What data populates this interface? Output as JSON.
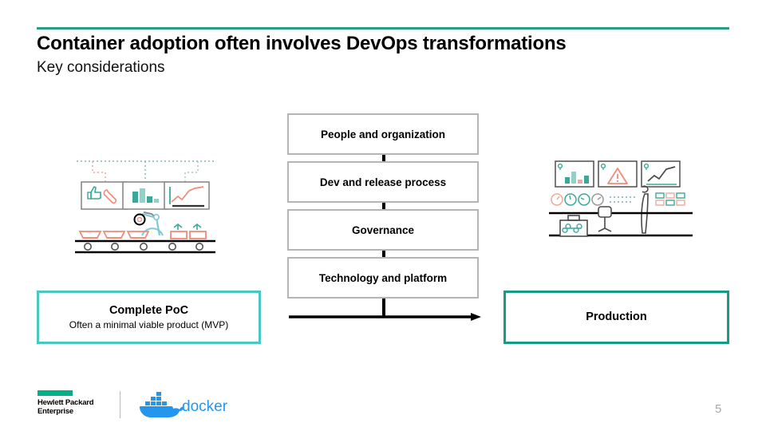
{
  "header": {
    "title": "Container adoption often involves DevOps transformations",
    "subtitle": "Key considerations",
    "rule_color": "#2a9d87"
  },
  "stack": {
    "boxes": [
      {
        "label": "People and organization"
      },
      {
        "label": "Dev and release process"
      },
      {
        "label": "Governance"
      },
      {
        "label": "Technology and platform"
      }
    ],
    "border_color": "#b5b5b5",
    "connector_color": "#000000"
  },
  "arrow": {
    "name": "progress-arrow",
    "direction": "right",
    "color": "#000000"
  },
  "callouts": {
    "left": {
      "title": "Complete PoC",
      "subtitle": "Often a minimal viable product (MVP)",
      "border_color": "#4cc6c2"
    },
    "right": {
      "title": "Production",
      "subtitle": "",
      "border_color": "#169c84"
    }
  },
  "illustrations": {
    "left": {
      "name": "factory-automation-illustration",
      "elements": [
        "dotted-network-line",
        "thumbs-up-wrench-screen",
        "bar-chart-screen",
        "line-graph-screen",
        "robotic-arm",
        "conveyor-belt",
        "packages"
      ],
      "accent_teal": "#3aa99a",
      "accent_coral": "#f08a7a"
    },
    "right": {
      "name": "datacenter-operations-illustration",
      "elements": [
        "bar-chart-monitor",
        "warning-monitor",
        "line-graph-monitor",
        "gauges",
        "technician",
        "office-chair",
        "toolbox",
        "server-racks"
      ],
      "accent_teal": "#3aa99a",
      "accent_coral": "#f08a7a"
    }
  },
  "footer": {
    "hpe": {
      "line1": "Hewlett Packard",
      "line2": "Enterprise",
      "bar_color": "#00b188"
    },
    "docker": {
      "wordmark": "docker",
      "color": "#2496ed"
    },
    "page_number": "5"
  }
}
